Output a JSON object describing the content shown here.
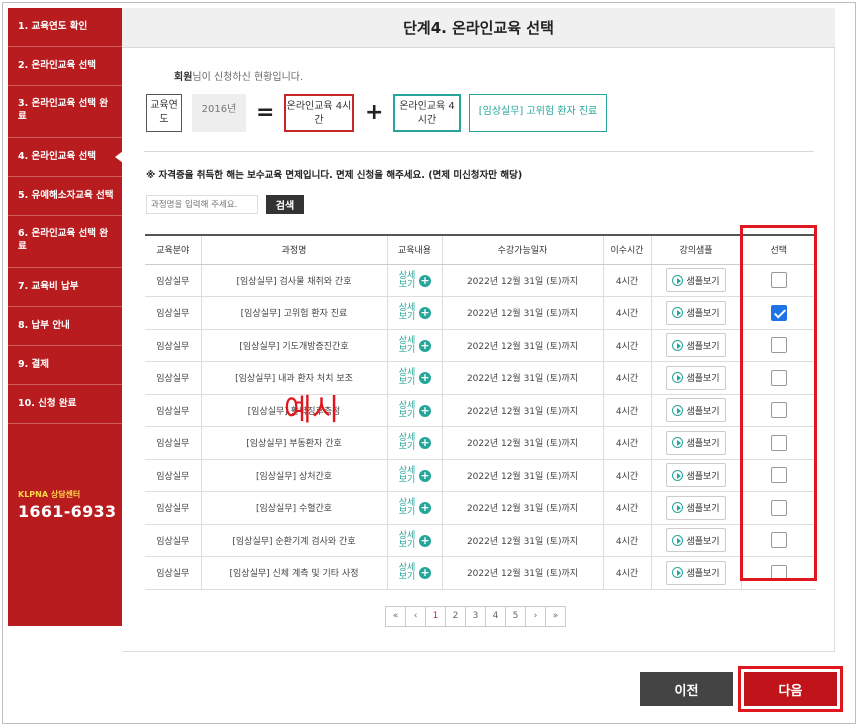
{
  "sidebar": {
    "items": [
      {
        "label": "1. 교육연도 확인"
      },
      {
        "label": "2. 온라인교육 선택"
      },
      {
        "label": "3. 온라인교육 선택 완료"
      },
      {
        "label": "4. 온라인교육 선택"
      },
      {
        "label": "5. 유예해소자교육 선택"
      },
      {
        "label": "6. 온라인교육 선택 완료"
      },
      {
        "label": "7. 교육비 납부"
      },
      {
        "label": "8. 납부 안내"
      },
      {
        "label": "9. 결제"
      },
      {
        "label": "10. 신청 완료"
      }
    ],
    "active_index": 3,
    "call_label": "KLPNA 상담센터",
    "call_number": "1661-6933"
  },
  "header": {
    "title": "단계4. 온라인교육 선택"
  },
  "status": {
    "name": "회원",
    "text": "님이 신청하신 현황입니다."
  },
  "formula": {
    "year_label": "교육연도",
    "year_value": "2016년",
    "equals": "=",
    "required": "온라인교육 4시간",
    "plus": "+",
    "selected_hours": "온라인교육 4시간",
    "selected_course": "[임상실무] 고위험 환자 진료"
  },
  "notice": "※ 자격증을 취득한 해는 보수교육 면제입니다. 면제 신청을 해주세요. (면제 미신청자만 해당)",
  "search": {
    "placeholder": "과정명을 입력해 주세요.",
    "button_label": "검색"
  },
  "table": {
    "headers": [
      "교육분야",
      "과정명",
      "교육내용",
      "수강가능일자",
      "이수시간",
      "강의샘플",
      "선택"
    ],
    "content_label": "상세보기",
    "sample_label": "샘플보기",
    "rows": [
      {
        "field": "임상실무",
        "course": "[임상실무] 검사물 채취와 간호",
        "date": "2022년 12월 31일 (토)까지",
        "hours": "4시간",
        "checked": false
      },
      {
        "field": "임상실무",
        "course": "[임상실무] 고위험 환자 진료",
        "date": "2022년 12월 31일 (토)까지",
        "hours": "4시간",
        "checked": true
      },
      {
        "field": "임상실무",
        "course": "[임상실무] 기도개방증진간호",
        "date": "2022년 12월 31일 (토)까지",
        "hours": "4시간",
        "checked": false
      },
      {
        "field": "임상실무",
        "course": "[임상실무] 내과 환자 처치 보조",
        "date": "2022년 12월 31일 (토)까지",
        "hours": "4시간",
        "checked": false
      },
      {
        "field": "임상실무",
        "course": "[임상실무] 활력징후측정",
        "date": "2022년 12월 31일 (토)까지",
        "hours": "4시간",
        "checked": false
      },
      {
        "field": "임상실무",
        "course": "[임상실무] 부동환자 간호",
        "date": "2022년 12월 31일 (토)까지",
        "hours": "4시간",
        "checked": false
      },
      {
        "field": "임상실무",
        "course": "[임상실무] 상처간호",
        "date": "2022년 12월 31일 (토)까지",
        "hours": "4시간",
        "checked": false
      },
      {
        "field": "임상실무",
        "course": "[임상실무] 수혈간호",
        "date": "2022년 12월 31일 (토)까지",
        "hours": "4시간",
        "checked": false
      },
      {
        "field": "임상실무",
        "course": "[임상실무] 순환기계 검사와 간호",
        "date": "2022년 12월 31일 (토)까지",
        "hours": "4시간",
        "checked": false
      },
      {
        "field": "임상실무",
        "course": "[임상실무] 신체 계측 및 기타 사정",
        "date": "2022년 12월 31일 (토)까지",
        "hours": "4시간",
        "checked": false
      }
    ]
  },
  "watermark": "예시",
  "pagination": {
    "first": "«",
    "prev": "‹",
    "pages": [
      "1",
      "2",
      "3",
      "4",
      "5"
    ],
    "current": "1",
    "next": "›",
    "last": "»"
  },
  "footer": {
    "prev_label": "이전",
    "next_label": "다음"
  },
  "colors": {
    "brand_red": "#b81c1f",
    "accent_teal": "#26a69a",
    "highlight_red": "#e0171f",
    "check_blue": "#1e73e8"
  }
}
